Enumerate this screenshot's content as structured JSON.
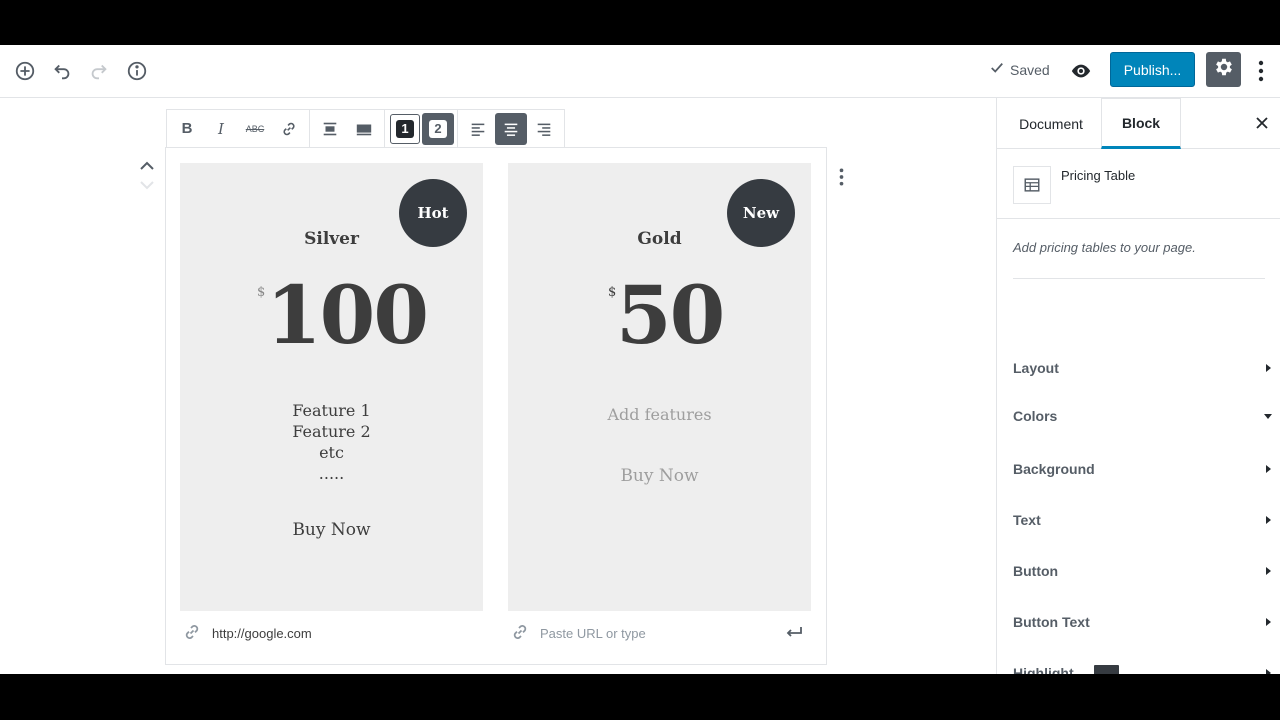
{
  "colors": {
    "accent": "#0085ba",
    "badge": "#363b41",
    "card_bg": "#eeeeee",
    "highlight_swatch": "#363b41"
  },
  "header": {
    "saved_label": "Saved",
    "publish_label": "Publish...",
    "icons": [
      "add-block-icon",
      "undo-icon",
      "redo-icon",
      "info-icon",
      "checkmark-icon",
      "preview-eye-icon",
      "gear-icon",
      "more-vertical-icon"
    ]
  },
  "toolbar": {
    "bold": "B",
    "italic": "I",
    "strikethrough": "ABC",
    "layout_1": "1",
    "layout_2": "2"
  },
  "plans": [
    {
      "badge": "Hot",
      "title": "Silver",
      "currency": "$",
      "amount": "100",
      "features": [
        "Feature 1",
        "Feature 2",
        "etc",
        "....."
      ],
      "button": "Buy Now",
      "url": "http://google.com"
    },
    {
      "badge": "New",
      "title": "Gold",
      "currency": "$",
      "amount": "50",
      "features_placeholder": "Add features",
      "button": "Buy Now",
      "url_placeholder": "Paste URL or type"
    }
  ],
  "sidebar": {
    "tabs": {
      "document": "Document",
      "block": "Block"
    },
    "block_name": "Pricing Table",
    "block_description": "Add pricing tables to your page.",
    "panels": [
      {
        "label": "Layout",
        "state": "collapsed"
      },
      {
        "label": "Colors",
        "state": "expanded"
      },
      {
        "label": "Background",
        "state": "collapsed"
      },
      {
        "label": "Text",
        "state": "collapsed"
      },
      {
        "label": "Button",
        "state": "collapsed"
      },
      {
        "label": "Button Text",
        "state": "collapsed"
      },
      {
        "label": "Highlight",
        "state": "collapsed"
      }
    ]
  }
}
